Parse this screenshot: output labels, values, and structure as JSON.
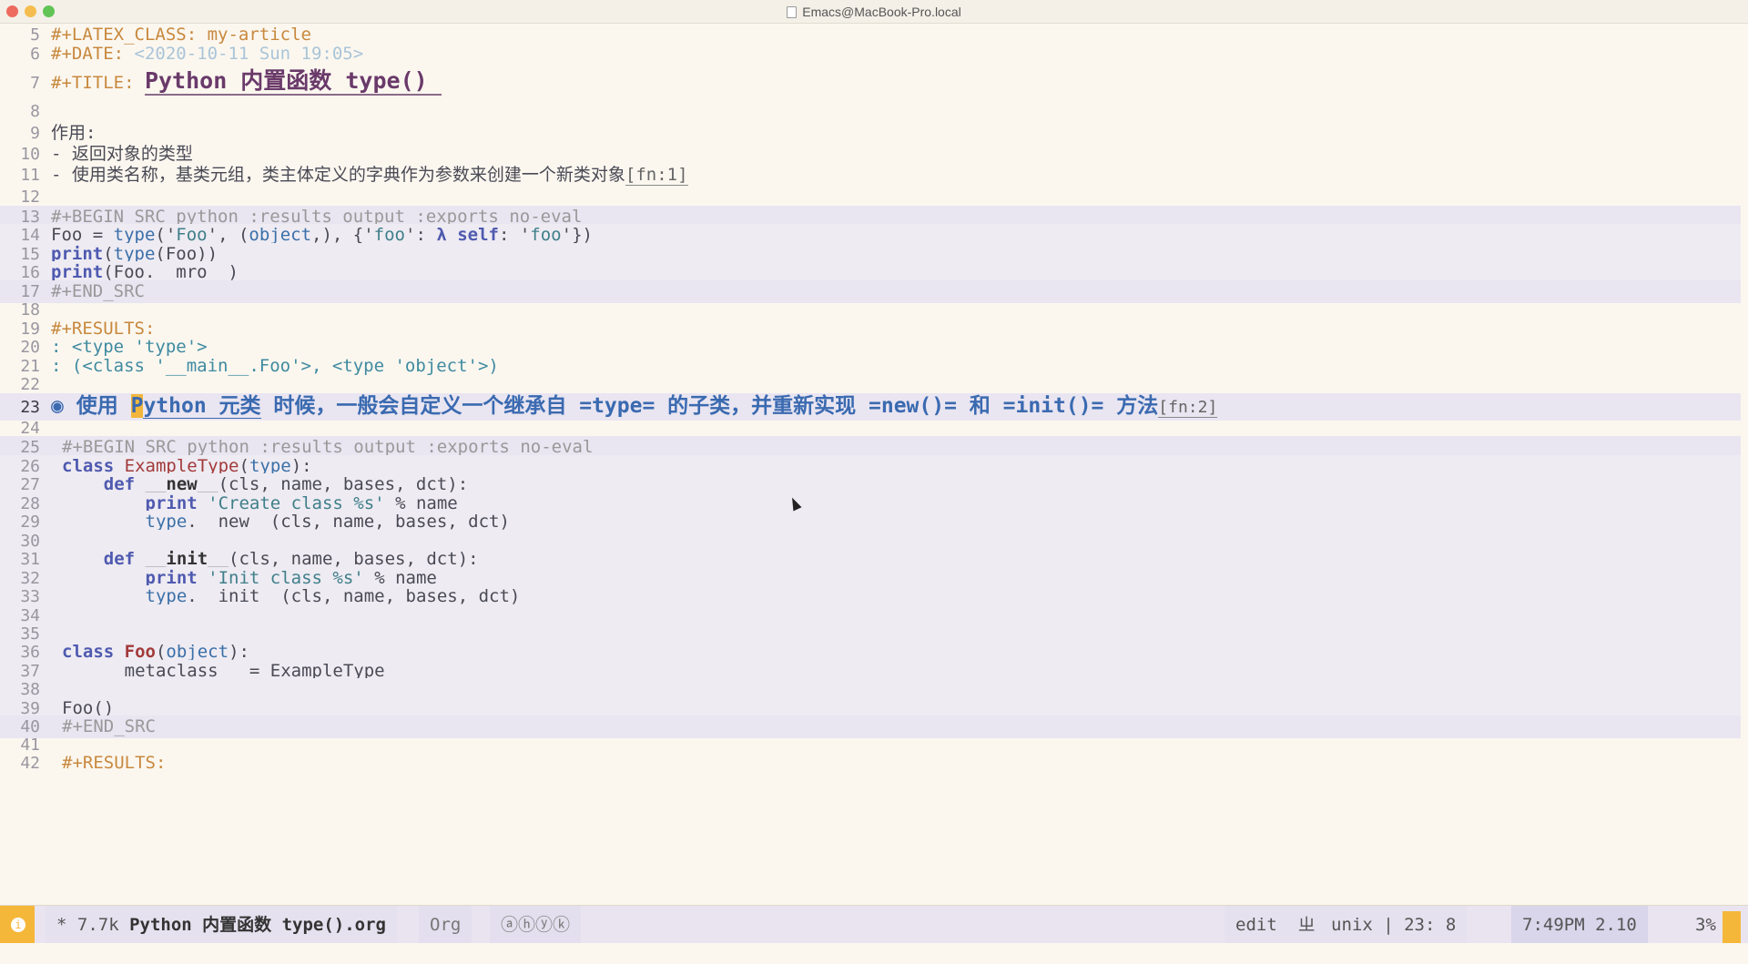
{
  "window": {
    "title": "Emacs@MacBook-Pro.local"
  },
  "lines": [
    {
      "n": "5",
      "t": "#+LATEX_CLASS: my-article"
    },
    {
      "n": "6",
      "t": "#+DATE: ",
      "date": "<2020-10-11 Sun 19:05>"
    },
    {
      "n": "7",
      "t": "#+TITLE: ",
      "title": "Python 内置函数 type() "
    },
    {
      "n": "8",
      "t": ""
    },
    {
      "n": "9",
      "t": "作用:"
    },
    {
      "n": "10",
      "t": "- 返回对象的类型"
    },
    {
      "n": "11",
      "t": "- 使用类名称，基类元组，类主体定义的字典作为参数来创建一个新类对象",
      "fn": "[fn:1]"
    },
    {
      "n": "12",
      "t": ""
    },
    {
      "n": "13",
      "t": "#+BEGIN_SRC python :results output :exports no-eval"
    },
    {
      "n": "14",
      "a": "Foo = ",
      "b": "type",
      "c": "('",
      "d": "Foo",
      "e": "', (",
      "f": "object",
      ",": ",), {'",
      "g": "foo",
      "h": "': ",
      "i": "λ self",
      ":": ": '",
      "j": "foo",
      "k": "'})"
    },
    {
      "n": "15",
      "a": "print",
      "b": "(",
      "c": "type",
      "d": "(Foo))"
    },
    {
      "n": "16",
      "a": "print",
      "b": "(Foo.__mro__)"
    },
    {
      "n": "17",
      "t": "#+END_SRC"
    },
    {
      "n": "18",
      "t": ""
    },
    {
      "n": "19",
      "t": "#+RESULTS:"
    },
    {
      "n": "20",
      "t": ": <type 'type'>"
    },
    {
      "n": "21",
      "t": ": (<class '__main__.Foo'>, <type 'object'>)"
    },
    {
      "n": "22",
      "t": ""
    },
    {
      "n": "23",
      "bullet": "◉",
      "h1": "使用 ",
      "h2": "P",
      "h3": "ython 元类",
      "h4": " 时候，一般会自定义一个继承自 =type= 的子类，并重新实现 =new()= 和 =init()= 方法",
      "fn": "[fn:2]"
    },
    {
      "n": "24",
      "t": ""
    },
    {
      "n": "25",
      "t": "#+BEGIN_SRC python :results output :exports no-eval"
    },
    {
      "n": "26",
      "a": "class ",
      "b": "ExampleType",
      "c": "(",
      "d": "type",
      "e": "):"
    },
    {
      "n": "27",
      "a": "    def ",
      "b": "__new__",
      "c": "(cls, name, bases, dct):"
    },
    {
      "n": "28",
      "a": "        print ",
      "b": "'Create class %s'",
      "c": " % name"
    },
    {
      "n": "29",
      "a": "        type",
      "b": ".__new__(cls, name, bases, dct)"
    },
    {
      "n": "30",
      "t": ""
    },
    {
      "n": "31",
      "a": "    def ",
      "b": "__init__",
      "c": "(cls, name, bases, dct):"
    },
    {
      "n": "32",
      "a": "        print ",
      "b": "'Init class %s'",
      "c": " % name"
    },
    {
      "n": "33",
      "a": "        type",
      "b": ".__init__(cls, name, bases, dct)"
    },
    {
      "n": "34",
      "t": ""
    },
    {
      "n": "35",
      "t": ""
    },
    {
      "n": "36",
      "a": "class ",
      "b": "Foo",
      "c": "(",
      "d": "object",
      "e": "):"
    },
    {
      "n": "37",
      "t": "    __metaclass__ = ExampleType"
    },
    {
      "n": "38",
      "t": ""
    },
    {
      "n": "39",
      "t": "Foo()"
    },
    {
      "n": "40",
      "t": "#+END_SRC"
    },
    {
      "n": "41",
      "t": ""
    },
    {
      "n": "42",
      "t": "#+RESULTS:"
    }
  ],
  "modeline": {
    "status_icon": "info-icon",
    "modified": "* 7.7k ",
    "filename": "Python 内置函数 type().org",
    "major_mode": "Org",
    "minor_icons": "ⓐⓗⓨⓚ",
    "edit_state": "edit",
    "encoding_icon": "ㄓ",
    "eol": "unix | 23: 8",
    "time": "7:49PM 2.10",
    "percent": "3%"
  },
  "colors": {
    "accent": "#f5b73a",
    "background": "#fbf7ef",
    "src_block": "#e9e5f1"
  }
}
